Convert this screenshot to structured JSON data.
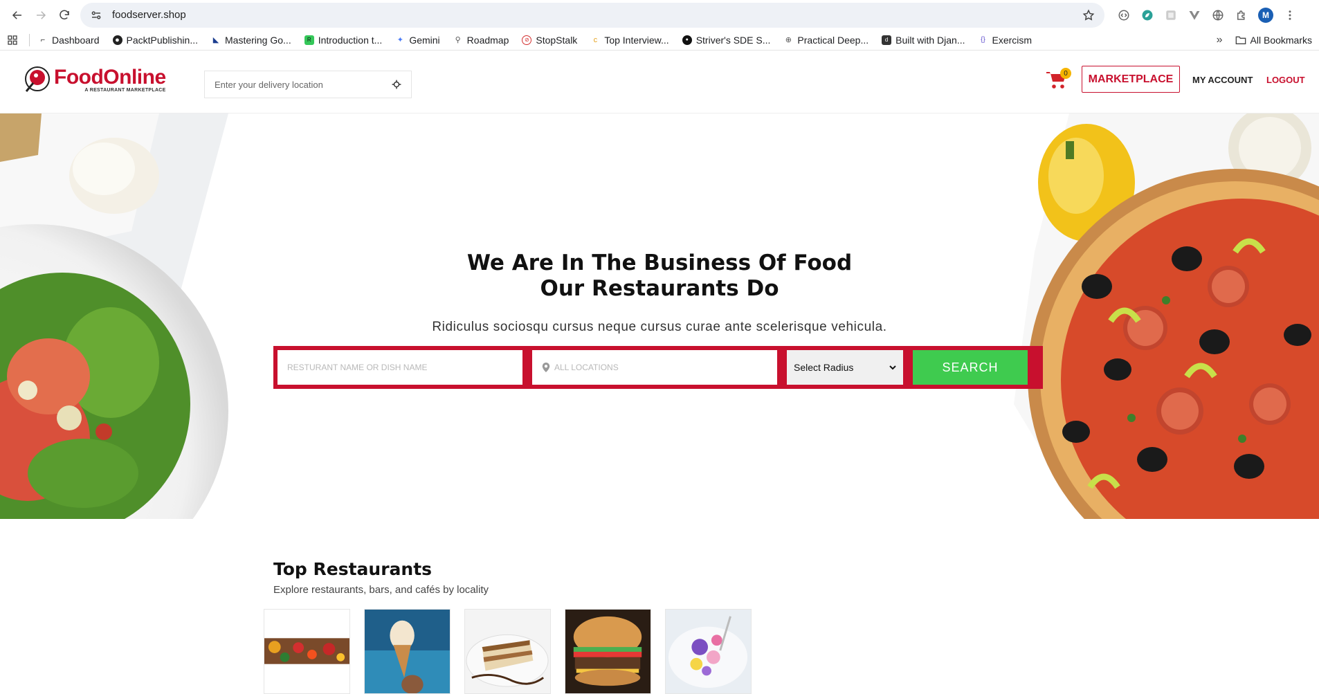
{
  "browser": {
    "url": "foodserver.shop",
    "profile_initial": "M",
    "bookmarks": [
      {
        "label": "Dashboard",
        "icon": "dashboard-icon"
      },
      {
        "label": "PacktPublishin...",
        "icon": "github-icon"
      },
      {
        "label": "Mastering Go...",
        "icon": "gopher-icon"
      },
      {
        "label": "Introduction t...",
        "icon": "rc-icon"
      },
      {
        "label": "Gemini",
        "icon": "gemini-icon"
      },
      {
        "label": "Roadmap",
        "icon": "rocket-icon"
      },
      {
        "label": "StopStalk",
        "icon": "stopstalk-icon"
      },
      {
        "label": "Top Interview...",
        "icon": "leetcode-icon"
      },
      {
        "label": "Striver's SDE S...",
        "icon": "tuf-icon"
      },
      {
        "label": "Practical Deep...",
        "icon": "globe-icon"
      },
      {
        "label": "Built with Djan...",
        "icon": "django-icon"
      },
      {
        "label": "Exercism",
        "icon": "exercism-icon"
      }
    ],
    "more_label": "»",
    "all_bookmarks_label": "All Bookmarks"
  },
  "header": {
    "logo_name": "FoodOnline",
    "logo_tagline": "A RESTAURANT MARKETPLACE",
    "delivery_placeholder": "Enter your delivery location",
    "cart_count": "0",
    "marketplace_label": "MARKETPLACE",
    "account_label": "MY ACCOUNT",
    "logout_label": "LOGOUT"
  },
  "hero": {
    "title_line1": "We Are In The Business Of Food",
    "title_line2": "Our Restaurants Do",
    "subtitle": "Ridiculus sociosqu cursus neque cursus curae ante scelerisque vehicula.",
    "dish_placeholder": "RESTURANT NAME OR DISH NAME",
    "location_placeholder": "ALL LOCATIONS",
    "radius_selected": "Select Radius",
    "search_label": "SEARCH"
  },
  "top_restaurants": {
    "title": "Top Restaurants",
    "subtitle": "Explore restaurants, bars, and cafés by locality"
  },
  "colors": {
    "brand_red": "#c8102e",
    "search_green": "#3fcb4f",
    "badge_yellow": "#f5b400"
  }
}
